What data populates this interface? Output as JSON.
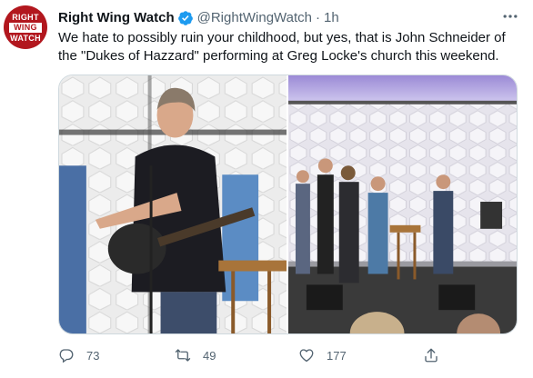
{
  "account": {
    "name": "Right Wing Watch",
    "handle": "@RightWingWatch",
    "separator": "·",
    "time": "1h",
    "avatar_lines": [
      "RIGHT",
      "WING",
      "WATCH"
    ]
  },
  "tweet": {
    "text": "We hate to possibly ruin your childhood, but yes, that is John Schneider of the \"Dukes of Hazzard\" performing at Greg Locke's church this weekend."
  },
  "actions": {
    "replies": "73",
    "retweets": "49",
    "likes": "177"
  },
  "colors": {
    "brand_red": "#b2171e",
    "verified_blue": "#1d9bf0",
    "muted_text": "#536471"
  },
  "icons": {
    "verified": "verified-badge-icon",
    "more": "more-icon",
    "reply": "reply-icon",
    "retweet": "retweet-icon",
    "like": "like-icon",
    "share": "share-icon"
  }
}
